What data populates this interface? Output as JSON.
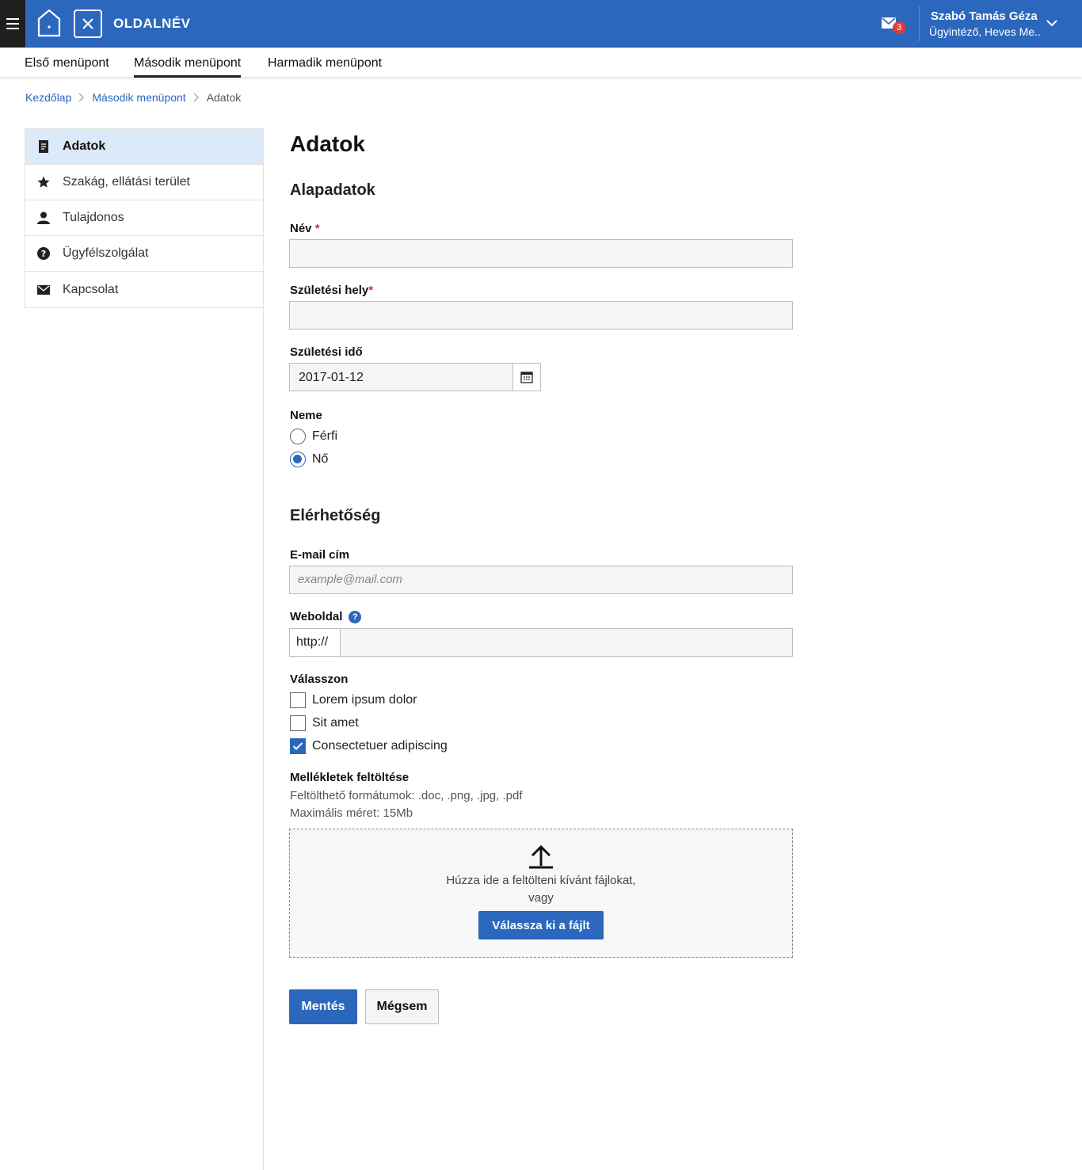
{
  "header": {
    "site_name": "OLDALNÉV",
    "mail_count": "3",
    "user_name": "Szabó Tamás Géza",
    "user_role": "Ügyintéző, Heves Me..",
    "accent_color": "#2b67bd"
  },
  "menu": {
    "items": [
      {
        "label": "Első menüpont"
      },
      {
        "label": "Második menüpont"
      },
      {
        "label": "Harmadik menüpont"
      }
    ],
    "active": "Második menüpont"
  },
  "breadcrumb": {
    "items": [
      {
        "label": "Kezdőlap"
      },
      {
        "label": "Második menüpont"
      },
      {
        "label": "Adatok"
      }
    ]
  },
  "sidebar": {
    "items": [
      {
        "label": "Adatok",
        "icon": "document-icon"
      },
      {
        "label": "Szakág, ellátási terület",
        "icon": "star-icon"
      },
      {
        "label": "Tulajdonos",
        "icon": "person-icon"
      },
      {
        "label": "Ügyfélszolgálat",
        "icon": "help-circle-icon"
      },
      {
        "label": "Kapcsolat",
        "icon": "mail-icon"
      }
    ]
  },
  "form": {
    "title": "Adatok",
    "section_basic": "Alapadatok",
    "name_label": "Név",
    "name_value": "",
    "birthplace_label": "Születési hely",
    "birthplace_value": "",
    "birthdate_label": "Születési idő",
    "birthdate_value": "2017-01-12",
    "gender_label": "Neme",
    "gender_options": [
      "Férfi",
      "Nő"
    ],
    "gender_selected": "Nő",
    "section_contact": "Elérhetőség",
    "email_label": "E-mail cím",
    "email_placeholder": "example@mail.com",
    "website_label": "Weboldal",
    "website_prefix": "http://",
    "website_value": "",
    "choose_label": "Válasszon",
    "checkboxes": [
      {
        "label": "Lorem ipsum dolor",
        "checked": false
      },
      {
        "label": "Sit amet",
        "checked": false
      },
      {
        "label": "Consectetuer adipiscing",
        "checked": true
      }
    ],
    "upload_label": "Mellékletek feltöltése",
    "upload_formats": "Feltölthető formátumok: .doc, .png, .jpg, .pdf",
    "upload_max": "Maximális méret: 15Mb",
    "drop_text_1": "Húzza ide a feltölteni kívánt fájlokat,",
    "drop_text_2": "vagy",
    "choose_file_button": "Válassza ki a fájlt",
    "save_button": "Mentés",
    "cancel_button": "Mégsem"
  }
}
